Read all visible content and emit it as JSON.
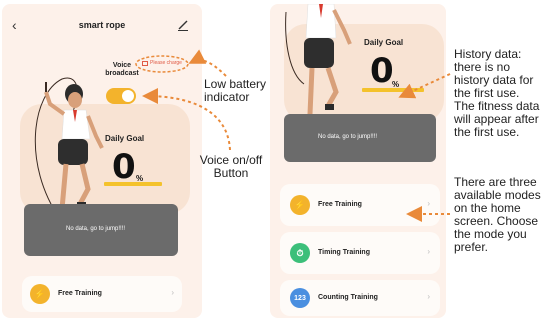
{
  "left_screen": {
    "header": {
      "back_icon": "chevron-left-icon",
      "title": "smart rope",
      "edit_icon": "pencil-icon"
    },
    "voice": {
      "label": "Voice\nbroadcast",
      "toggle_on": true,
      "toggle_color": "#f3b32c"
    },
    "battery": {
      "label": "Please charge",
      "color": "#e05a45"
    },
    "goal": {
      "title": "Daily Goal",
      "value": "0",
      "unit": "%"
    },
    "no_data": "No data, go to jump!!!!",
    "modes": [
      {
        "label": "Free Training",
        "icon": "lightning-icon",
        "color": "#f3b32c"
      }
    ]
  },
  "right_screen": {
    "goal": {
      "title": "Daily Goal",
      "value": "0",
      "unit": "%"
    },
    "no_data": "No data, go to jump!!!!",
    "modes": [
      {
        "label": "Free Training",
        "icon": "lightning-icon",
        "color": "#f3b32c"
      },
      {
        "label": "Timing Training",
        "icon": "stopwatch-icon",
        "color": "#3cbf7a"
      },
      {
        "label": "Counting Training",
        "icon": "123",
        "color": "#4a8fe0"
      }
    ]
  },
  "annotations": {
    "low_battery": [
      "Low battery",
      "indicator"
    ],
    "voice_button": [
      "Voice on/off",
      "Button"
    ],
    "history": [
      "History data:",
      "there is no",
      "history data for",
      "the first use.",
      "The fitness data",
      "will appear after",
      "the first use."
    ],
    "modes": [
      "There are three",
      "available modes",
      "on the home",
      "screen. Choose",
      "the mode you",
      "prefer."
    ]
  },
  "colors": {
    "screen_bg": "#fdf1ea",
    "arrow": "#e98a3a",
    "accent_yellow": "#f4c22c"
  }
}
